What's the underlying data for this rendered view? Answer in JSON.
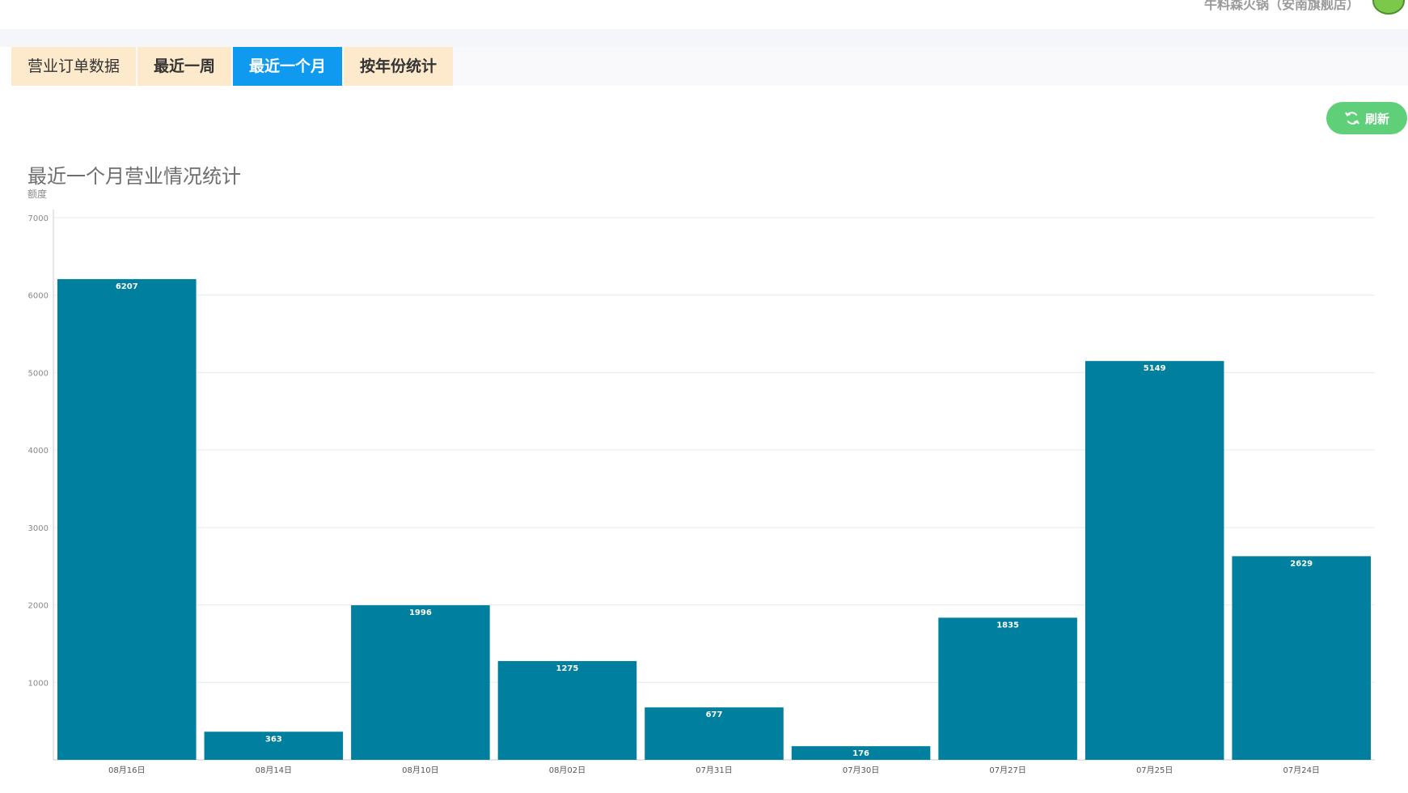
{
  "header": {
    "store_name": "牛料森火锅（安南旗舰店）"
  },
  "tabs": [
    {
      "label": "营业订单数据",
      "active": false
    },
    {
      "label": "最近一周",
      "active": false
    },
    {
      "label": "最近一个月",
      "active": true
    },
    {
      "label": "按年份统计",
      "active": false
    }
  ],
  "toolbar": {
    "refresh_label": "刷新"
  },
  "colors": {
    "bar": "#007f9e",
    "active_tab": "#0f9af0",
    "inactive_tab": "#fde9cc",
    "refresh_button": "#5fcf79"
  },
  "chart_data": {
    "type": "bar",
    "title": "最近一个月营业情况统计",
    "ylabel": "额度",
    "xlabel": "",
    "categories": [
      "08月16日",
      "08月14日",
      "08月10日",
      "08月02日",
      "07月31日",
      "07月30日",
      "07月27日",
      "07月25日",
      "07月24日"
    ],
    "values": [
      6207,
      363,
      1996,
      1275,
      677,
      176,
      1835,
      5149,
      2629
    ],
    "ylim": [
      0,
      7000
    ],
    "yticks": [
      1000,
      2000,
      3000,
      4000,
      5000,
      6000,
      7000
    ],
    "grid": true,
    "legend": "none"
  }
}
